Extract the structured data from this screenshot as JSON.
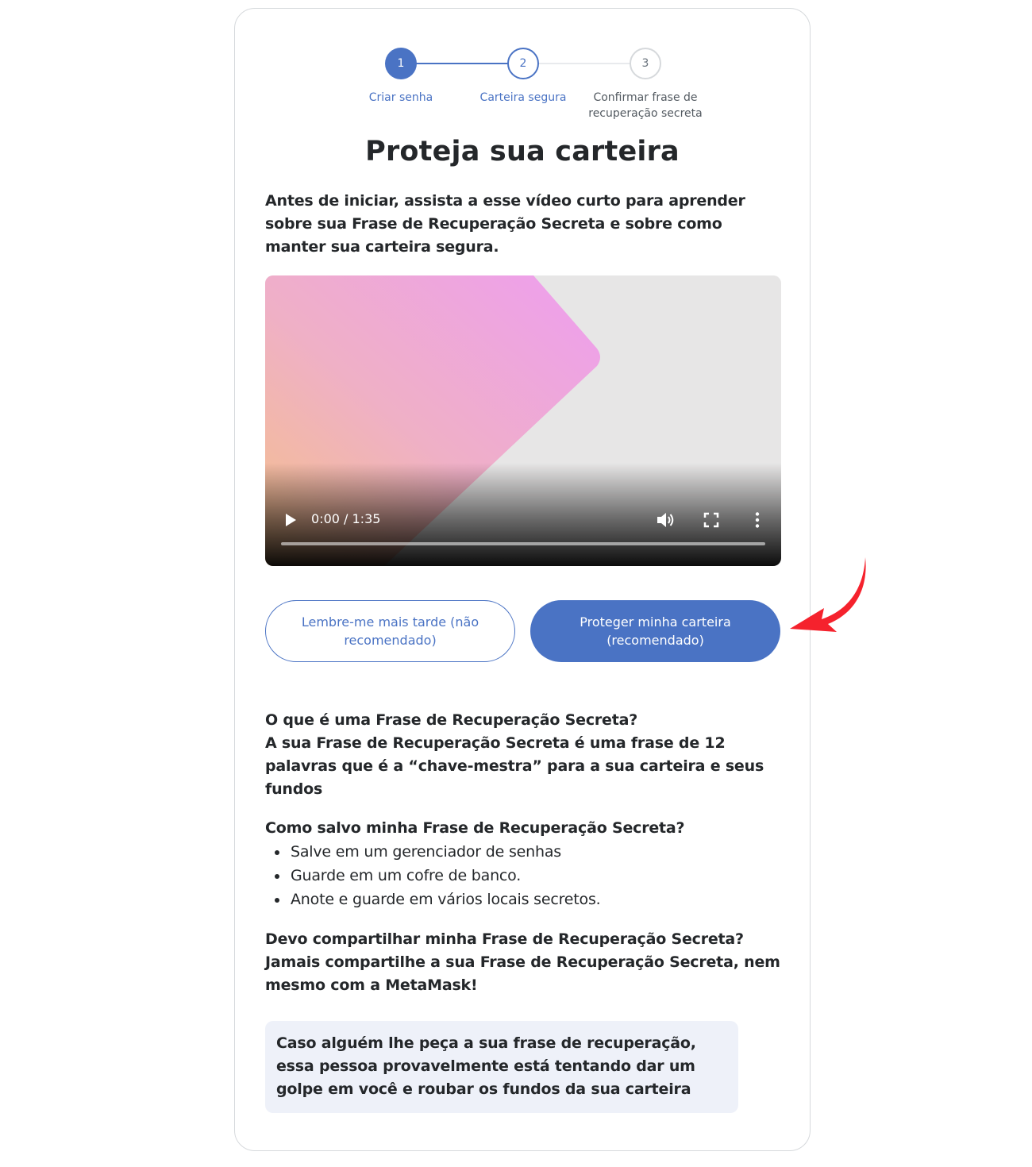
{
  "stepper": {
    "steps": [
      {
        "number": "1",
        "label": "Criar senha"
      },
      {
        "number": "2",
        "label": "Carteira segura"
      },
      {
        "number": "3",
        "label": "Confirmar frase de recuperação secreta"
      }
    ]
  },
  "title": "Proteja sua carteira",
  "intro": "Antes de iniciar, assista a esse vídeo curto para aprender sobre sua Frase de Recuperação Secreta e sobre como manter sua carteira segura.",
  "video": {
    "time": "0:00 / 1:35",
    "icons": [
      "play-icon",
      "volume-icon",
      "fullscreen-icon",
      "more-vertical-icon"
    ]
  },
  "buttons": {
    "later": "Lembre-me mais tarde (não recomendado)",
    "secure": "Proteger minha carteira (recomendado)"
  },
  "faq": {
    "q1": "O que é uma Frase de Recuperação Secreta?",
    "a1": "A sua Frase de Recuperação Secreta é uma frase de 12 palavras que é a “chave-mestra” para a sua carteira e seus fundos",
    "q2": "Como salvo minha Frase de Recuperação Secreta?",
    "a2_items": [
      "Salve em um gerenciador de senhas",
      "Guarde em um cofre de banco.",
      "Anote e guarde em vários locais secretos."
    ],
    "q3": "Devo compartilhar minha Frase de Recuperação Secreta?",
    "a3": "Jamais compartilhe a sua Frase de Recuperação Secreta, nem mesmo com a MetaMask!"
  },
  "warning": "Caso alguém lhe peça a sua frase de recuperação, essa pessoa provavelmente está tentando dar um golpe em você e roubar os fundos da sua carteira",
  "colors": {
    "accent": "#4a73c4",
    "arrow": "#f5222d",
    "warning_bg": "#eef1f9"
  }
}
